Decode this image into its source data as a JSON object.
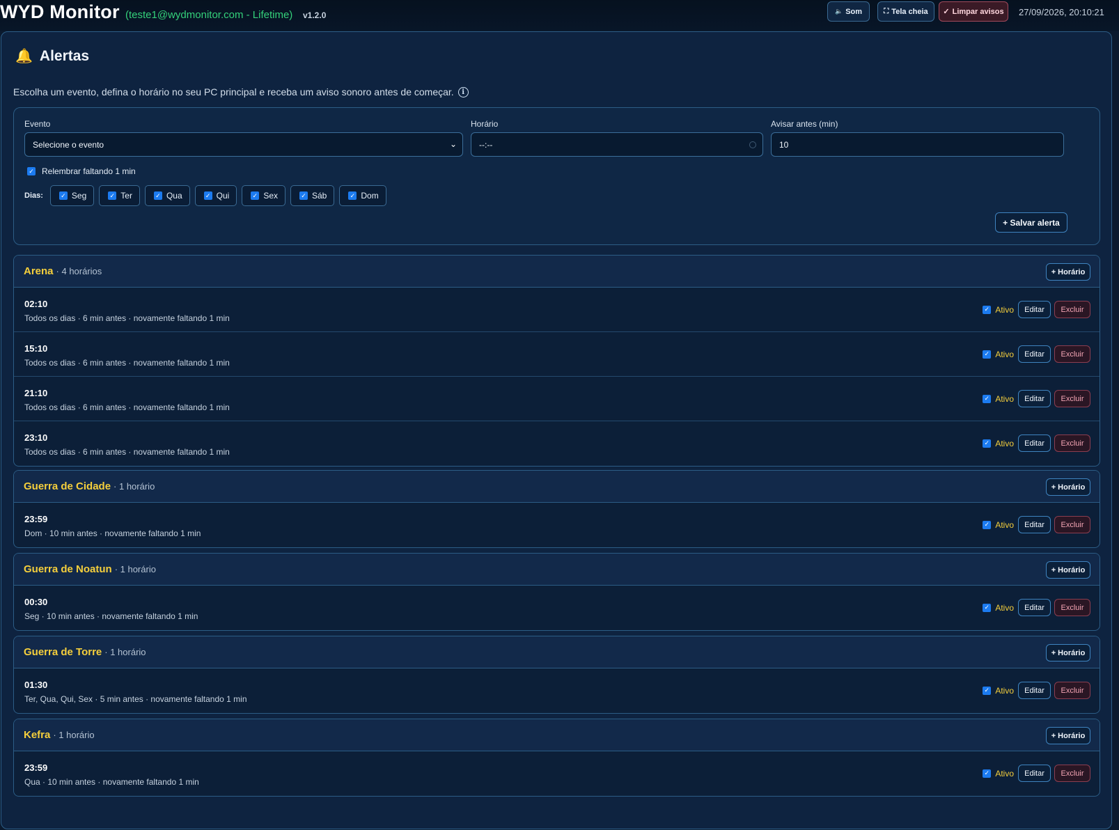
{
  "header": {
    "app_name": "WYD Monitor",
    "account": "(teste1@wydmonitor.com - Lifetime)",
    "version": "v1.2.0",
    "buttons": {
      "sound": "Som",
      "sound_icon": "speaker-icon",
      "fullscreen": "Tela cheia",
      "fullscreen_icon": "fullscreen-icon",
      "clear": "Limpar avisos",
      "clear_icon": "check-icon"
    },
    "datetime": "27/09/2026, 20:10:21"
  },
  "alerts": {
    "title": "Alertas",
    "title_icon": "bell-icon",
    "description": "Escolha um evento, defina o horário no seu PC principal e receba um aviso sonoro antes de começar.",
    "info_icon": "info-icon",
    "form": {
      "event_label": "Evento",
      "event_value": "Selecione o evento",
      "time_label": "Horário",
      "time_value": "--:--",
      "advance_label": "Avisar antes (min)",
      "advance_value": "10",
      "remind_label": "Relembrar faltando 1 min",
      "remind_checked": true,
      "days_label": "Dias:",
      "days": [
        {
          "label": "Seg",
          "checked": true
        },
        {
          "label": "Ter",
          "checked": true
        },
        {
          "label": "Qua",
          "checked": true
        },
        {
          "label": "Qui",
          "checked": true
        },
        {
          "label": "Sex",
          "checked": true
        },
        {
          "label": "Sáb",
          "checked": true
        },
        {
          "label": "Dom",
          "checked": true
        }
      ],
      "save_label": "+ Salvar alerta"
    },
    "add_time_label": "+ Horário",
    "active_label": "Ativo",
    "edit_label": "Editar",
    "delete_label": "Excluir",
    "groups": [
      {
        "name": "Arena",
        "count": "· 4 horários",
        "items": [
          {
            "time": "02:10",
            "detail": "Todos os dias · 6 min antes · novamente faltando 1 min",
            "active": true
          },
          {
            "time": "15:10",
            "detail": "Todos os dias · 6 min antes · novamente faltando 1 min",
            "active": true
          },
          {
            "time": "21:10",
            "detail": "Todos os dias · 6 min antes · novamente faltando 1 min",
            "active": true
          },
          {
            "time": "23:10",
            "detail": "Todos os dias · 6 min antes · novamente faltando 1 min",
            "active": true
          }
        ]
      },
      {
        "name": "Guerra de Cidade",
        "count": "· 1 horário",
        "items": [
          {
            "time": "23:59",
            "detail": "Dom · 10 min antes · novamente faltando 1 min",
            "active": true
          }
        ]
      },
      {
        "name": "Guerra de Noatun",
        "count": "· 1 horário",
        "items": [
          {
            "time": "00:30",
            "detail": "Seg · 10 min antes · novamente faltando 1 min",
            "active": true
          }
        ]
      },
      {
        "name": "Guerra de Torre",
        "count": "· 1 horário",
        "items": [
          {
            "time": "01:30",
            "detail": "Ter, Qua, Qui, Sex · 5 min antes · novamente faltando 1 min",
            "active": true
          }
        ]
      },
      {
        "name": "Kefra",
        "count": "· 1 horário",
        "items": [
          {
            "time": "23:59",
            "detail": "Qua · 10 min antes · novamente faltando 1 min",
            "active": true
          }
        ]
      }
    ]
  }
}
